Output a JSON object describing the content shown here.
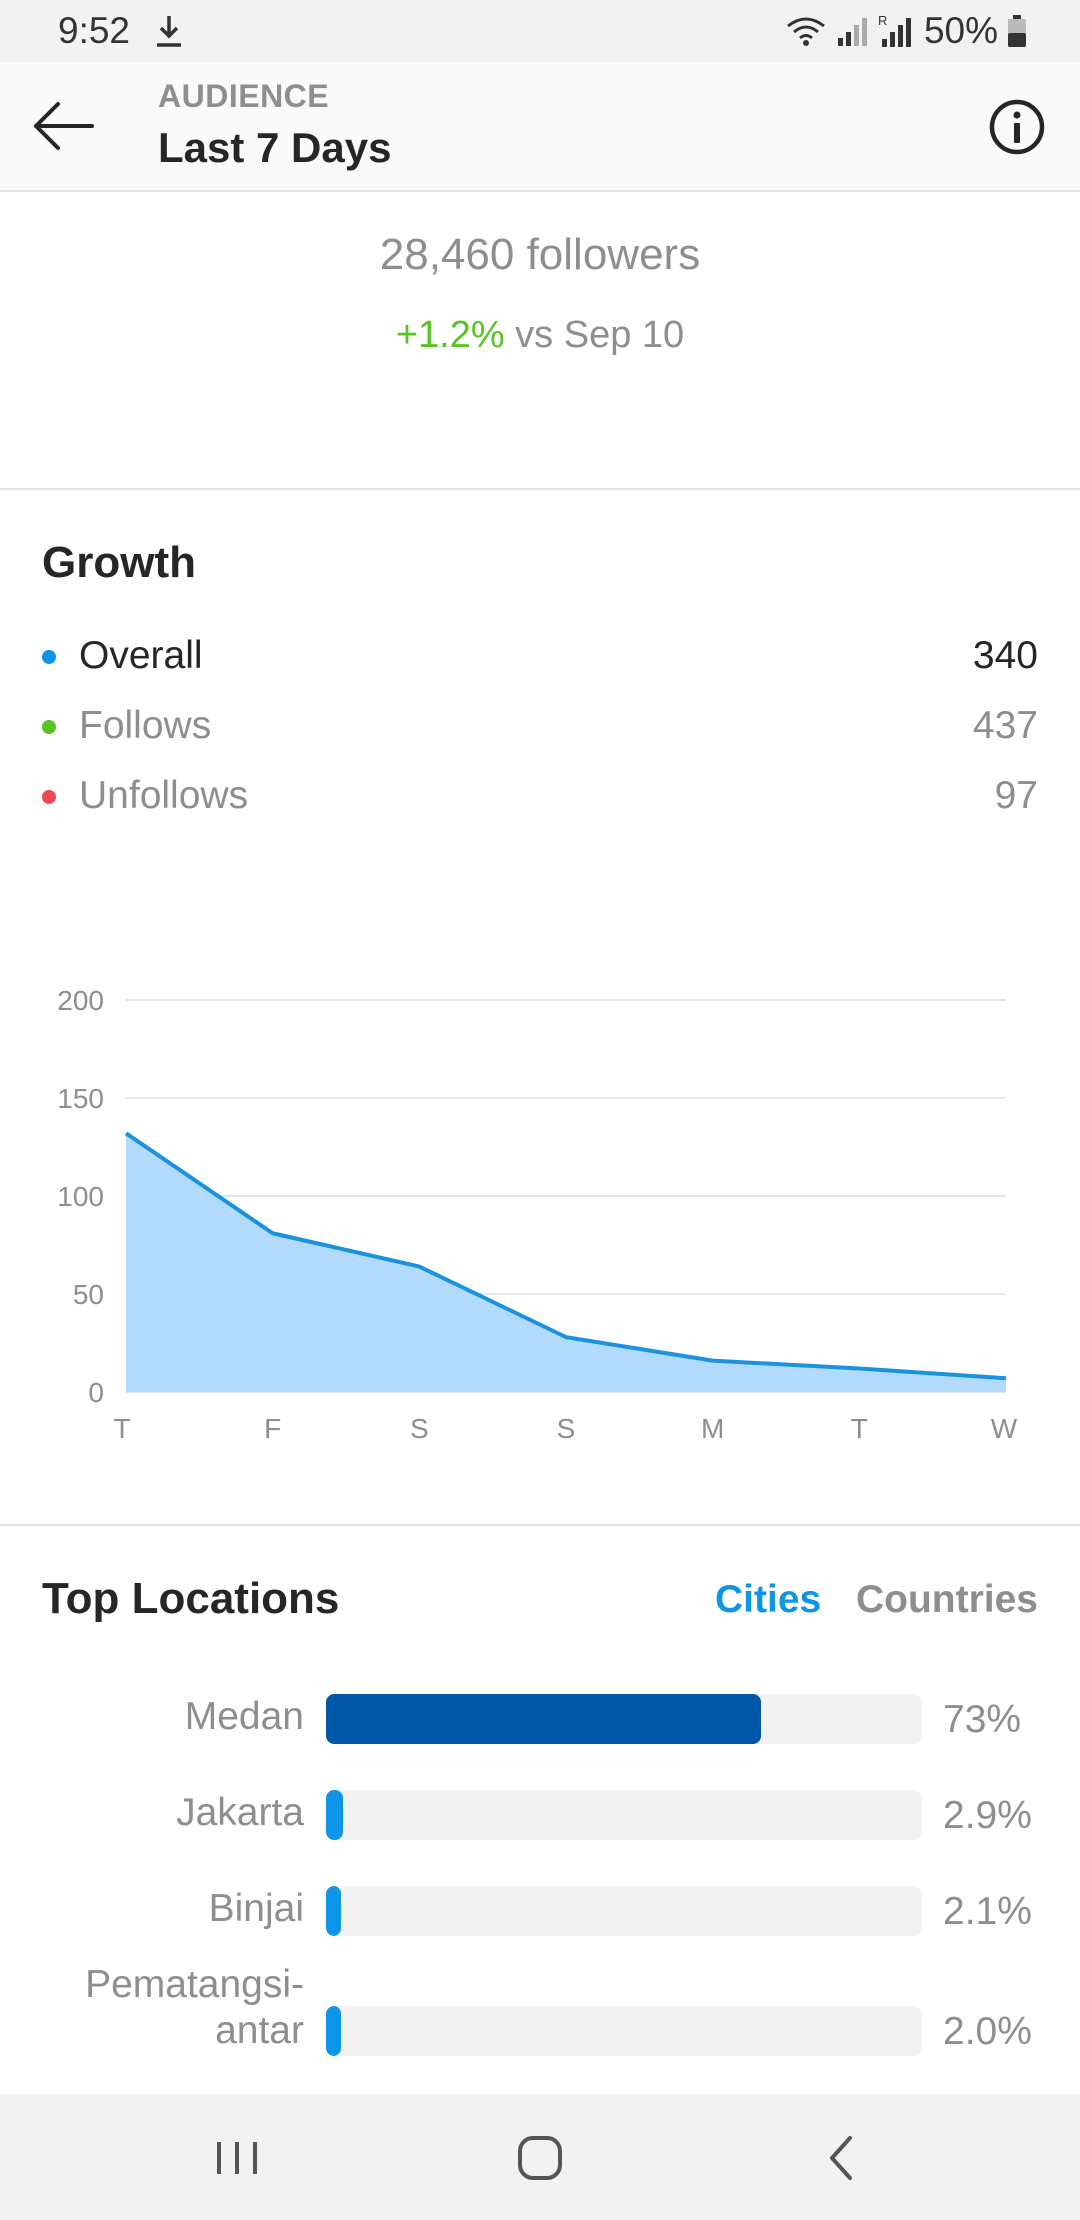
{
  "status_bar": {
    "time": "9:52",
    "battery": "50%",
    "icons": [
      "download-icon",
      "wifi-icon",
      "signal-icon",
      "signal-roaming-icon",
      "battery-icon"
    ]
  },
  "header": {
    "subtitle": "AUDIENCE",
    "title": "Last 7 Days",
    "back_icon": "arrow-left-icon",
    "info_icon": "info-icon"
  },
  "summary": {
    "followers": "28,460 followers",
    "change": "+1.2%",
    "change_suffix": " vs Sep 10",
    "change_color": "#58c322"
  },
  "growth": {
    "title": "Growth",
    "legend": [
      {
        "label": "Overall",
        "value": "340",
        "color": "#0f95e8",
        "text_color": "#262626"
      },
      {
        "label": "Follows",
        "value": "437",
        "color": "#58c322",
        "text_color": "#8e8e8e"
      },
      {
        "label": "Unfollows",
        "value": "97",
        "color": "#ed4956",
        "text_color": "#8e8e8e"
      }
    ]
  },
  "chart_data": {
    "type": "area",
    "categories": [
      "T",
      "F",
      "S",
      "S",
      "M",
      "T",
      "W"
    ],
    "series": [
      {
        "values": [
          132,
          81,
          64,
          28,
          16,
          12,
          7
        ],
        "line_color": "#1a92e0",
        "fill_color": "#b2dafc"
      }
    ],
    "yticks": [
      0,
      50,
      100,
      150,
      200
    ],
    "ylim": [
      0,
      200
    ],
    "grid": true
  },
  "locations": {
    "title": "Top Locations",
    "tab_cities": "Cities",
    "tab_countries": "Countries",
    "active_tab": "Cities",
    "rows": [
      {
        "name_lines": [
          "Medan"
        ],
        "percent": "73%",
        "fraction": 0.73,
        "color": "#0057a8"
      },
      {
        "name_lines": [
          "Jakarta"
        ],
        "percent": "2.9%",
        "fraction": 0.029,
        "color": "#0f95e8"
      },
      {
        "name_lines": [
          "Binjai"
        ],
        "percent": "2.1%",
        "fraction": 0.021,
        "color": "#0f95e8"
      },
      {
        "name_lines": [
          "Pematangsi-",
          "antar"
        ],
        "percent": "2.0%",
        "fraction": 0.02,
        "color": "#0f95e8"
      }
    ]
  },
  "nav_bar": {
    "icons": [
      "recent-apps-icon",
      "home-icon",
      "back-icon"
    ]
  }
}
